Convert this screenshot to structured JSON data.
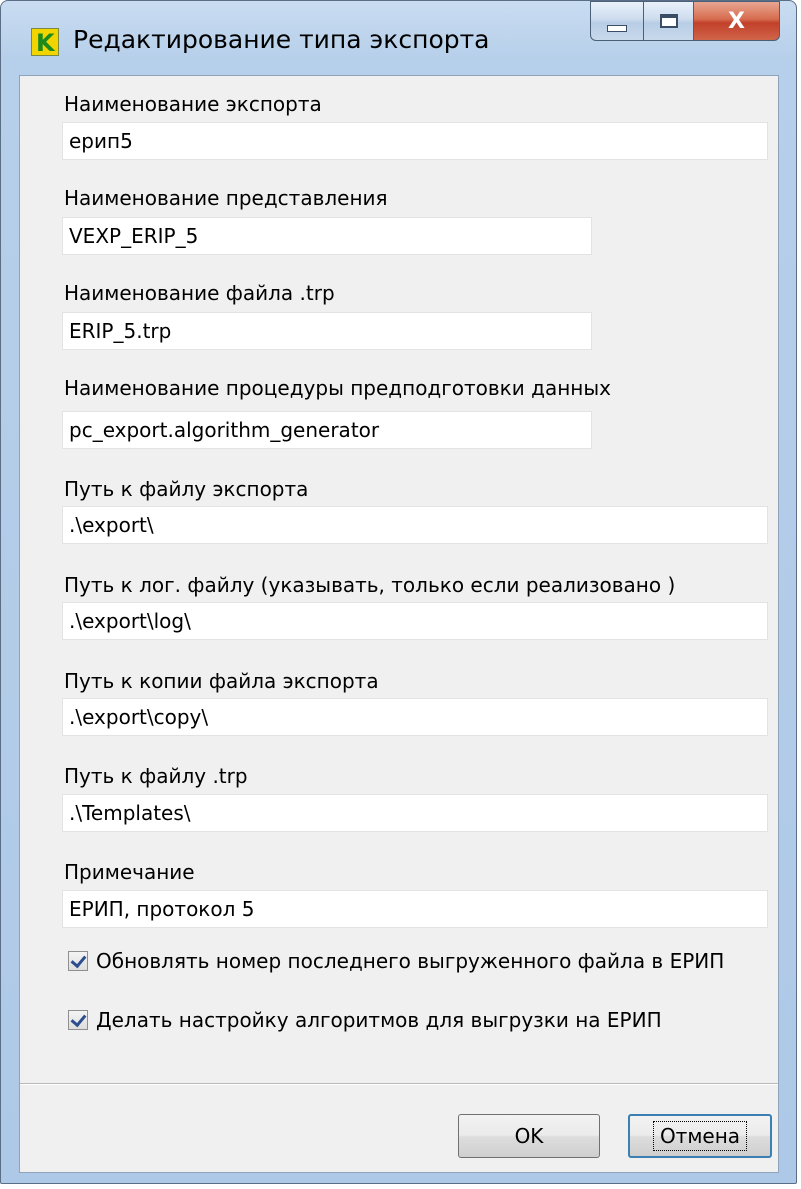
{
  "window": {
    "title": "Редактирование типа экспорта",
    "close_glyph": "X"
  },
  "fields": [
    {
      "label": "Наименование экспорта",
      "value": "ерип5"
    },
    {
      "label": "Наименование представления",
      "value": "VEXP_ERIP_5"
    },
    {
      "label": "Наименование файла .trp",
      "value": "ERIP_5.trp"
    },
    {
      "label": "Наименование процедуры предподготовки данных",
      "value": "pc_export.algorithm_generator"
    },
    {
      "label": "Путь к файлу экспорта",
      "value": ".\\export\\"
    },
    {
      "label": "Путь к лог. файлу (указывать, только если реализовано )",
      "value": ".\\export\\log\\"
    },
    {
      "label": "Путь к копии файла экспорта",
      "value": ".\\export\\copy\\"
    },
    {
      "label": "Путь к файлу .trp",
      "value": ".\\Templates\\"
    },
    {
      "label": "Примечание",
      "value": "ЕРИП, протокол 5"
    }
  ],
  "checkboxes": [
    {
      "label": "Обновлять номер последнего выгруженного файла в ЕРИП",
      "checked": true
    },
    {
      "label": "Делать настройку алгоритмов для выгрузки на ЕРИП",
      "checked": true
    }
  ],
  "buttons": {
    "ok": "OK",
    "cancel": "Отмена"
  },
  "icons": {
    "app": "app-k-icon",
    "minimize": "minimize-icon",
    "maximize": "maximize-icon",
    "close": "close-icon"
  }
}
